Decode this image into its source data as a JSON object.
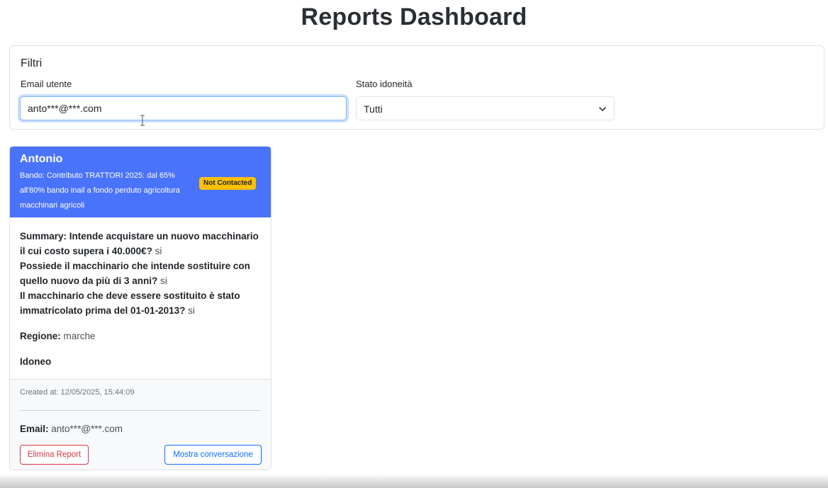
{
  "page": {
    "title": "Reports Dashboard"
  },
  "filters": {
    "title": "Filtri",
    "email_label": "Email utente",
    "email_value": "anto***@***.com",
    "status_label": "Stato idoneità",
    "status_value": "Tutti"
  },
  "report": {
    "name": "Antonio",
    "bando": "Bando: Contributo TRATTORI 2025: dal 65% all'80% bando inail a fondo perduto agricoltura macchinari agricoli",
    "status_badge": "Not Contacted",
    "summary": [
      {
        "q": "Summary: Intende acquistare un nuovo macchinario il cui costo supera i 40.000€?",
        "a": "si"
      },
      {
        "q": "Possiede il macchinario che intende sostituire con quello nuovo da più di 3 anni?",
        "a": "si"
      },
      {
        "q": "Il macchinario che deve essere sostituito è stato immatricolato prima del 01-01-2013?",
        "a": "si"
      }
    ],
    "region_label": "Regione:",
    "region_value": "marche",
    "eligibility": "Idoneo",
    "created_at": "Created at: 12/05/2025, 15:44:09",
    "email_label": "Email:",
    "email_value": "anto***@***.com",
    "delete_label": "Elimina Report",
    "conversation_label": "Mostra conversazione"
  },
  "colors": {
    "header_bg": "#4a73fb",
    "badge_bg": "#ffc107",
    "danger": "#dc3545",
    "primary": "#0d6efd"
  },
  "icons": {
    "select": "chevron-down-icon",
    "cursor": "text-cursor-icon"
  }
}
